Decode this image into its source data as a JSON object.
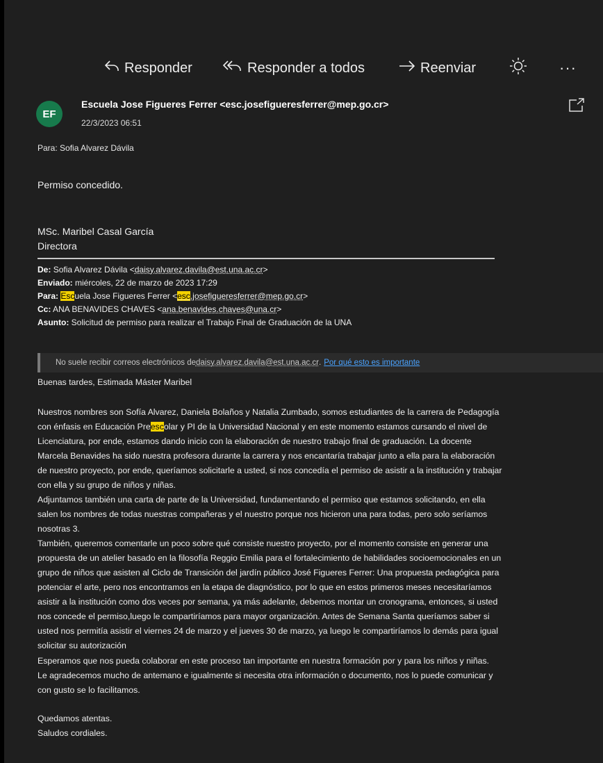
{
  "toolbar": {
    "reply_label": "Responder",
    "reply_all_label": "Responder a todos",
    "forward_label": "Reenviar",
    "more_label": "···"
  },
  "message": {
    "avatar_initials": "EF",
    "avatar_color": "#177a4c",
    "sender": "Escuela Jose Figueres Ferrer <esc.josefigueresferrer@mep.go.cr>",
    "date": "22/3/2023 06:51",
    "to_line": "Para: Sofia Alvarez Dávila",
    "body": "Permiso concedido.",
    "signature_name": "MSc. Maribel Casal García",
    "signature_title": "Directora"
  },
  "quoted_header": {
    "from_label": "De:",
    "from_name": "Sofia Alvarez Dávila <",
    "from_email": "daisy.alvarez.davila@est.una.ac.cr",
    "sent_label": "Enviado:",
    "sent_value": "miércoles, 22 de marzo de 2023 17:29",
    "to_label": "Para:",
    "to_name_hl": "Esc",
    "to_name_rest": "uela Jose Figueres Ferrer <",
    "to_email_hl": "esc",
    "to_email_rest": ".josefigueresferrer@mep.go.cr",
    "cc_label": "Cc:",
    "cc_name": "ANA BENAVIDES CHAVES <",
    "cc_email": "ana.benavides.chaves@una.cr",
    "subject_label": "Asunto:",
    "subject_value": "Solicitud de permiso para realizar el Trabajo Final de Graduación de la UNA",
    "close_bracket": ">"
  },
  "warning": {
    "text": "No suele recibir correos electrónicos de ",
    "email": "daisy.alvarez.davila@est.una.ac.cr",
    "period": ".",
    "link": "Por qué esto es importante"
  },
  "quoted_body": {
    "greeting": "Buenas tardes, Estimada Máster Maribel",
    "p1": [
      "Nuestros nombres son Sofía Alvarez, Daniela Bolaños y Natalia Zumbado, somos estudiantes de la carrera de Pedagogía",
      "con énfasis en Educación Pre|esc|olar y PI de la Universidad Nacional y en este momento estamos cursando el nivel de",
      "Licenciatura, por ende, estamos dando inicio con la elaboración de nuestro trabajo final de graduación. La docente",
      "Marcela Benavides ha sido nuestra profesora durante la carrera y nos encantaría trabajar junto a ella para la elaboración",
      "de nuestro proyecto, por ende, queríamos solicitarle a usted, si nos concedía el permiso de asistir a la institución y trabajar",
      "con ella y su grupo de niños y niñas.",
      "Adjuntamos también una carta de parte de la Universidad, fundamentando el permiso que estamos solicitando, en ella",
      "salen los nombres de todas nuestras compañeras y el nuestro porque nos hicieron una para todas, pero solo seríamos",
      "nosotras 3.",
      "También, queremos comentarle un poco sobre qué consiste nuestro proyecto, por el momento consiste en generar una",
      "propuesta de un atelier basado en la filosofía Reggio Emilia para el fortalecimiento de habilidades socioemocionales en un",
      "grupo de niños que asisten al Ciclo de Transición del jardín público José Figueres Ferrer: Una propuesta pedagógica para",
      "potenciar el arte, pero nos encontramos en la etapa de diagnóstico, por lo que en estos primeros meses necesitaríamos",
      "asistir a la institución como dos veces por semana, ya más adelante, debemos montar un cronograma, entonces, si usted",
      "nos concede el permiso,luego le compartiríamos para mayor organización. Antes de Semana Santa queríamos saber si",
      "usted nos permitía asistir el viernes 24 de marzo y el jueves 30 de marzo, ya luego le compartiríamos lo demás para igual",
      "solicitar su autorización"
    ],
    "p2": [
      "Esperamos que nos pueda colaborar en este proceso tan importante en nuestra formación por y para los niños y niñas.",
      "Le agradecemos mucho de antemano e igualmente si necesita otra información o documento, nos lo puede comunicar y",
      "con gusto se lo facilitamos."
    ],
    "closing1": "Quedamos atentas.",
    "closing2": "Saludos cordiales."
  },
  "icons": {
    "reply": "reply-arrow-icon",
    "reply_all": "reply-all-arrow-icon",
    "forward": "forward-arrow-icon",
    "theme": "sun-brightness-icon",
    "popout": "open-in-new-window-icon"
  }
}
